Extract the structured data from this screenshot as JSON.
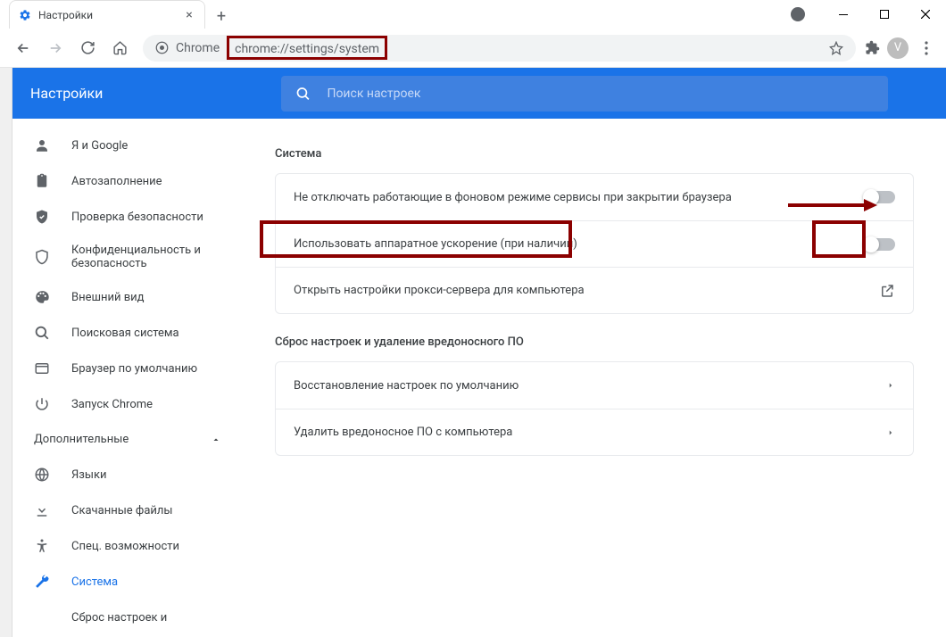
{
  "tab": {
    "title": "Настройки"
  },
  "urlbar": {
    "prefix": "Chrome",
    "url_pre": "chrome://",
    "url_hl": "settings",
    "url_post": "/system"
  },
  "avatar_letter": "V",
  "header": {
    "title": "Настройки"
  },
  "search": {
    "placeholder": "Поиск настроек"
  },
  "sidebar": {
    "items": [
      {
        "label": "Я и Google"
      },
      {
        "label": "Автозаполнение"
      },
      {
        "label": "Проверка безопасности"
      },
      {
        "label": "Конфиденциальность и безопасность"
      },
      {
        "label": "Внешний вид"
      },
      {
        "label": "Поисковая система"
      },
      {
        "label": "Браузер по умолчанию"
      },
      {
        "label": "Запуск Chrome"
      }
    ],
    "advanced_label": "Дополнительные",
    "adv_items": [
      {
        "label": "Языки"
      },
      {
        "label": "Скачанные файлы"
      },
      {
        "label": "Спец. возможности"
      },
      {
        "label": "Система"
      },
      {
        "label": "Сброс настроек и"
      }
    ]
  },
  "main": {
    "section1_title": "Система",
    "rows1": [
      "Не отключать работающие в фоновом режиме сервисы при закрытии браузера",
      "Использовать аппаратное ускорение (при наличии)",
      "Открыть настройки прокси-сервера для компьютера"
    ],
    "section2_title": "Сброс настроек и удаление вредоносного ПО",
    "rows2": [
      "Восстановление настроек по умолчанию",
      "Удалить вредоносное ПО с компьютера"
    ]
  }
}
